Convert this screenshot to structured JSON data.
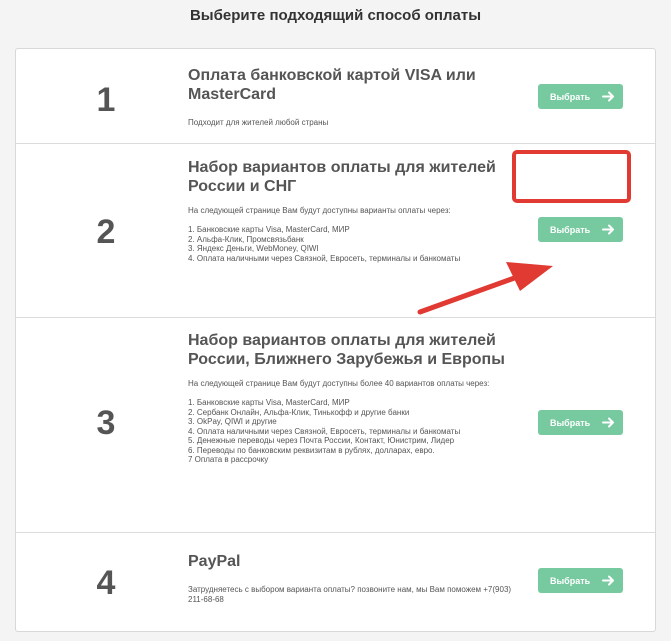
{
  "page": {
    "title": "Выберите подходящий способ оплаты"
  },
  "options": [
    {
      "number": "1",
      "title": "Оплата банковской картой VISA или MasterCard",
      "description": "Подходит для жителей любой страны",
      "button_label": "Выбрать"
    },
    {
      "number": "2",
      "title": "Набор вариантов оплаты для жителей России и СНГ",
      "description": "На следующей странице Вам будут доступны варианты оплаты через:\n\n1. Банковские карты Visa, MasterCard, МИР\n2. Альфа-Клик, Промсвязьбанк\n3. Яндекс Деньги, WebMoney, QIWI\n4. Оплата наличными через Связной, Евросеть, терминалы и банкоматы",
      "button_label": "Выбрать"
    },
    {
      "number": "3",
      "title": "Набор вариантов оплаты для жителей России, Ближнего Зарубежья и Европы",
      "description": "На следующей странице Вам будут доступны более 40 вариантов оплаты через:\n\n1. Банковские карты Visa, MasterCard, МИР\n2. Сербанк Онлайн, Альфа-Клик, Тинькофф и другие банки\n3. OkPay, QIWI и другие\n4. Оплата наличными через Связной, Евросеть, терминалы и банкоматы\n5. Денежные переводы через Почта России, Контакт, Юнистрим, Лидер\n6. Переводы по банковским реквизитам в рублях, долларах, евро.\n7 Оплата в рассрочку",
      "button_label": "Выбрать"
    },
    {
      "number": "4",
      "title": "PayPal",
      "description": "Затрудняетесь с выбором варианта оплаты? позвоните нам, мы Вам поможем +7(903) 211-68-68",
      "button_label": "Выбрать"
    }
  ],
  "icons": {
    "button_arrow": "arrow-right-icon"
  },
  "colors": {
    "button": "#77c9a0",
    "highlight": "#e03a32",
    "text": "#555555",
    "background": "#f4f4f4"
  }
}
